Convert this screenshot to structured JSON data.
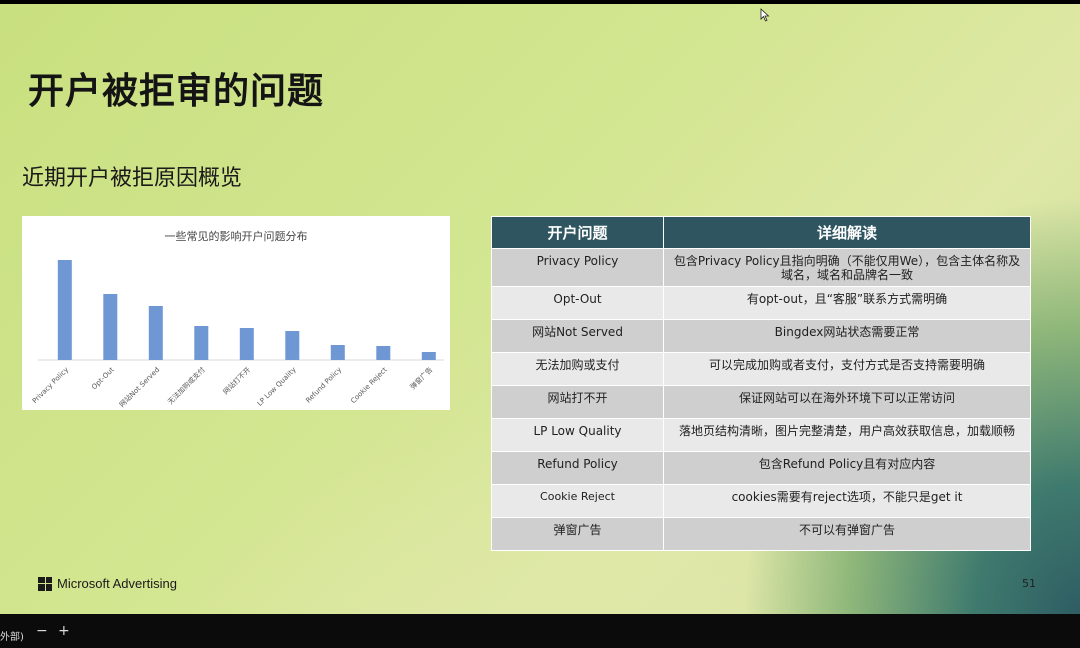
{
  "slide": {
    "title": "开户被拒审的问题",
    "subtitle": "近期开户被拒原因概览",
    "page_number": "51",
    "brand": "Microsoft Advertising"
  },
  "chart_data": {
    "type": "bar",
    "title": "一些常见的影响开户问题分布",
    "categories": [
      "Privacy Policy",
      "Opt-Out",
      "网站Not Served",
      "无法加购或支付",
      "网站打不开",
      "LP Low Quality",
      "Refund Policy",
      "Cookie Reject",
      "弹窗广告"
    ],
    "values": [
      100,
      66,
      54,
      34,
      32,
      29,
      15,
      14,
      8
    ],
    "ylim": [
      0,
      110
    ],
    "color": "#6f97d4",
    "grid": false,
    "legend": "none"
  },
  "table": {
    "headers": [
      "开户问题",
      "详细解读"
    ],
    "rows": [
      {
        "issue": "Privacy Policy",
        "detail": "包含Privacy Policy且指向明确（不能仅用We），包含主体名称及域名，域名和品牌名一致"
      },
      {
        "issue": "Opt-Out",
        "detail": "有opt-out，且“客服”联系方式需明确"
      },
      {
        "issue": "网站Not Served",
        "detail": "Bingdex网站状态需要正常"
      },
      {
        "issue": "无法加购或支付",
        "detail": "可以完成加购或者支付，支付方式是否支持需要明确"
      },
      {
        "issue": "网站打不开",
        "detail": "保证网站可以在海外环境下可以正常访问"
      },
      {
        "issue": "LP Low Quality",
        "detail": "落地页结构清晰，图片完整清楚，用户高效获取信息，加载顺畅"
      },
      {
        "issue": "Refund Policy",
        "detail": "包含Refund Policy且有对应内容"
      },
      {
        "issue": "Cookie Reject",
        "detail": "cookies需要有reject选项，不能只是get it"
      },
      {
        "issue": "弹窗广告",
        "detail": "不可以有弹窗广告"
      }
    ]
  },
  "taskbar": {
    "label": "外部)",
    "minus": "−",
    "plus": "+"
  },
  "colors": {
    "table_header": "#2f5660",
    "row_odd": "#cfcfcf",
    "row_even": "#e9e9e9",
    "bar": "#6f97d4"
  }
}
